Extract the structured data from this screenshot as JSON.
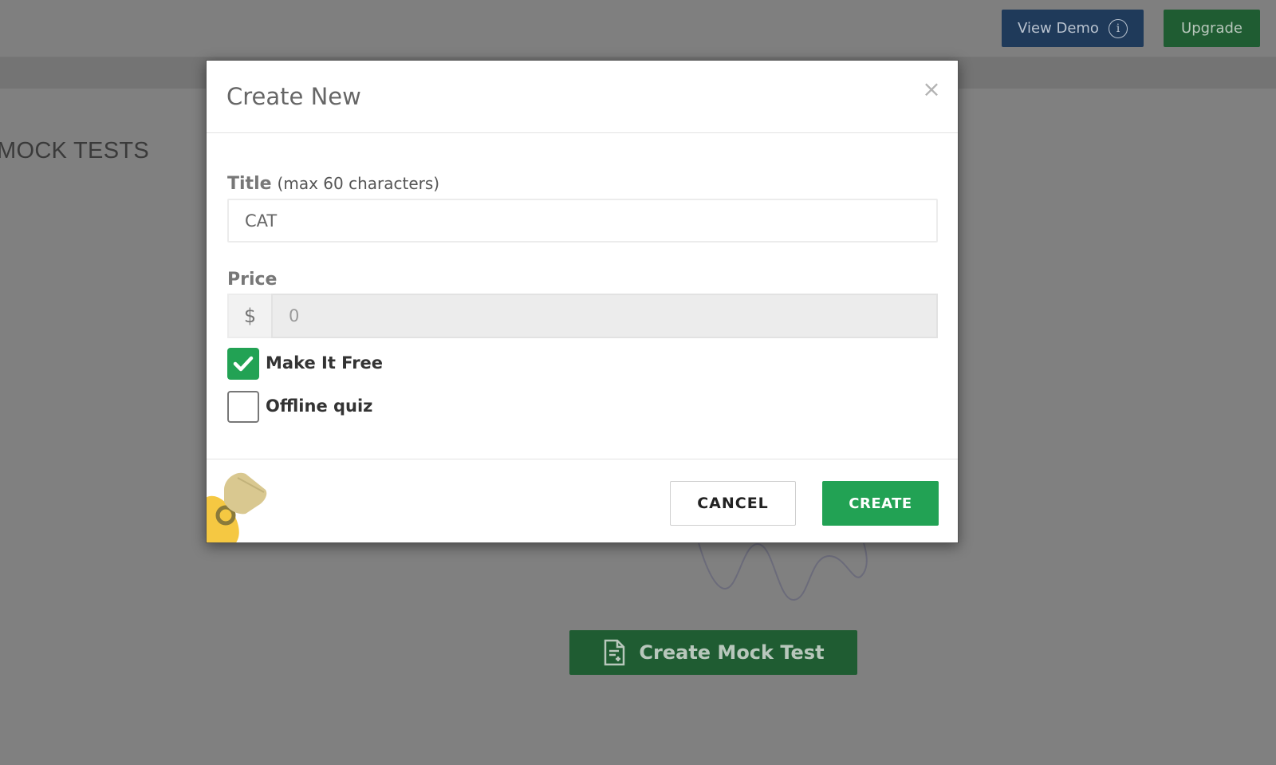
{
  "header": {
    "view_demo_label": "View Demo",
    "view_demo_icon": "info-icon",
    "upgrade_label": "Upgrade"
  },
  "page": {
    "section_title": "MOCK TESTS",
    "create_mock_test_label": "Create Mock Test",
    "create_mock_test_icon": "document-plus-icon"
  },
  "modal": {
    "title": "Create New",
    "close_icon": "close-icon",
    "close_glyph": "×",
    "title_field": {
      "label": "Title",
      "hint": "(max 60 characters)",
      "value": "CAT"
    },
    "price_field": {
      "label": "Price",
      "currency_symbol": "$",
      "value": "0",
      "disabled": true
    },
    "checkboxes": [
      {
        "label": "Make It Free",
        "checked": true
      },
      {
        "label": "Offline quiz",
        "checked": false
      }
    ],
    "cancel_label": "CANCEL",
    "create_label": "CREATE"
  },
  "colors": {
    "primary_green": "#22a254",
    "demo_blue": "#1f3a5a",
    "overlay_gray": "#808080"
  }
}
